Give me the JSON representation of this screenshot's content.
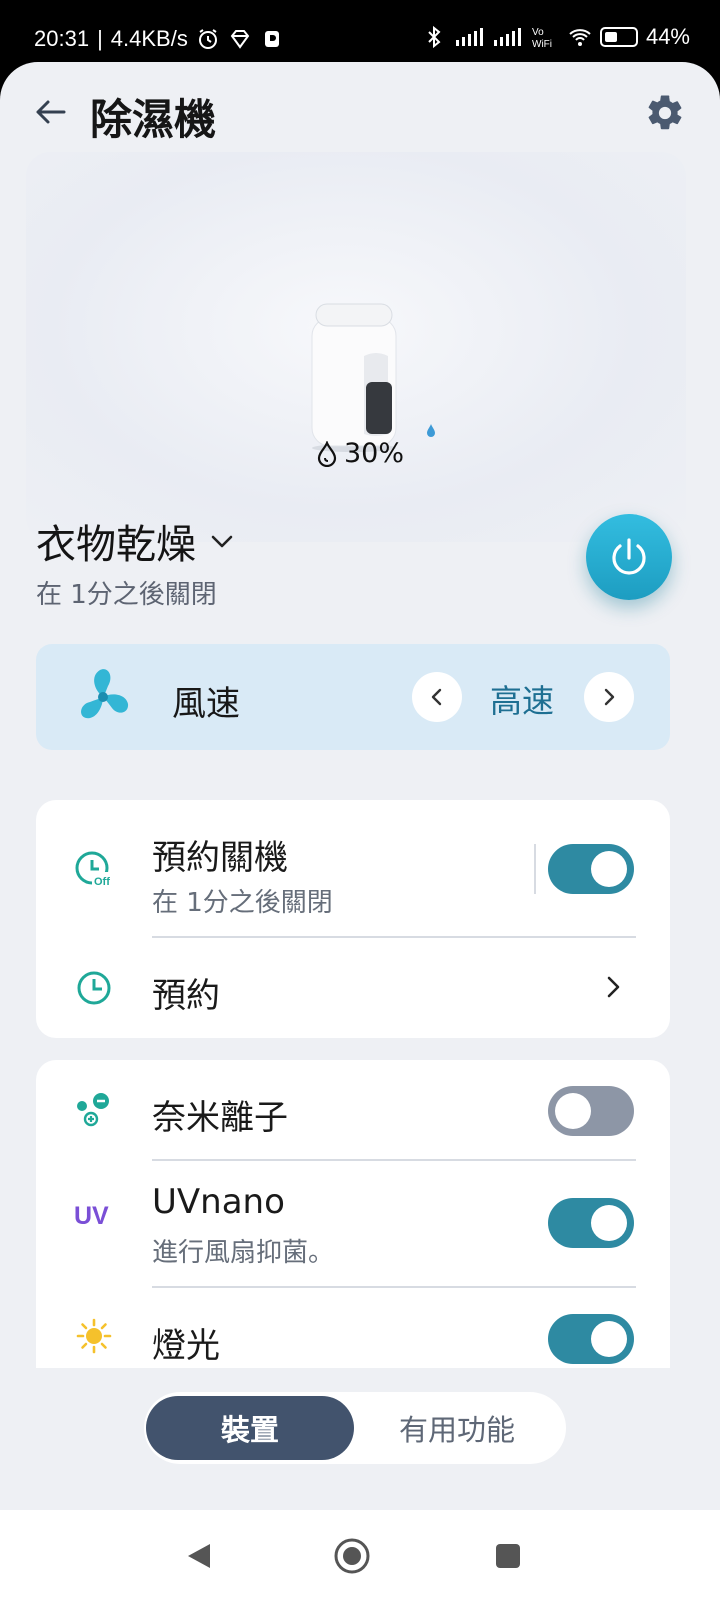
{
  "status_bar": {
    "time": "20:31",
    "speed": "4.4KB/s",
    "battery": "44%",
    "battery_level": 0.44
  },
  "header": {
    "title": "除濕機"
  },
  "hero": {
    "humidity": "30%"
  },
  "mode": {
    "label": "衣物乾燥",
    "subtitle": "在 1分之後關閉"
  },
  "fan": {
    "label": "風速",
    "value": "高速"
  },
  "schedule_card": {
    "items": [
      {
        "title": "預約關機",
        "subtitle": "在 1分之後關閉",
        "toggle_on": true
      },
      {
        "title": "預約"
      }
    ]
  },
  "features_card": {
    "items": [
      {
        "title": "奈米離子",
        "toggle_on": false
      },
      {
        "title": "UVnano",
        "subtitle": "進行風扇抑菌。",
        "icon_text": "UV",
        "toggle_on": true
      },
      {
        "title": "燈光",
        "toggle_on": true
      }
    ]
  },
  "bottom_tabs": {
    "tabs": [
      "裝置",
      "有用功能"
    ],
    "active": 0
  },
  "colors": {
    "accent": "#2e8aa2",
    "power": "#1d9dc1",
    "tab_active": "#42536d",
    "fan_card": "#d9eaf6"
  },
  "icons": {
    "back": "arrow-left-icon",
    "settings": "gear-icon",
    "drop": "water-drop-icon",
    "power": "power-icon",
    "fan": "fan-icon",
    "timer_off": "timer-off-icon",
    "schedule": "schedule-icon",
    "ion": "nano-ion-icon",
    "light": "sun-icon"
  }
}
